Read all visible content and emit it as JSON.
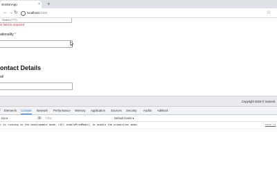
{
  "browser": {
    "tab_title": "strationApp",
    "new_tab_symbol": "+",
    "close_symbol": "×",
    "url_host": "localhost",
    "url_port": ":4200"
  },
  "form": {
    "select_value": "Select (???)",
    "error_message": "is field is required",
    "nationality_label": "ationality",
    "required_mark": "*",
    "contact_section_title": "ontact Details",
    "email_label": "ail"
  },
  "footer": {
    "copyright": "Copyright 2019 © SomeSi"
  },
  "devtools": {
    "tabs": [
      "Elements",
      "Console",
      "Network",
      "Performance",
      "Memory",
      "Application",
      "Sources",
      "Security",
      "Audits",
      "AdBlock"
    ],
    "active_tab": "Console",
    "context": "top",
    "filter_placeholder": "Filter",
    "levels_label": "Default levels ▾",
    "console_message": "r is running in the development mode. Call enableProdMode() to enable the production mode.",
    "console_source": "core.js"
  }
}
